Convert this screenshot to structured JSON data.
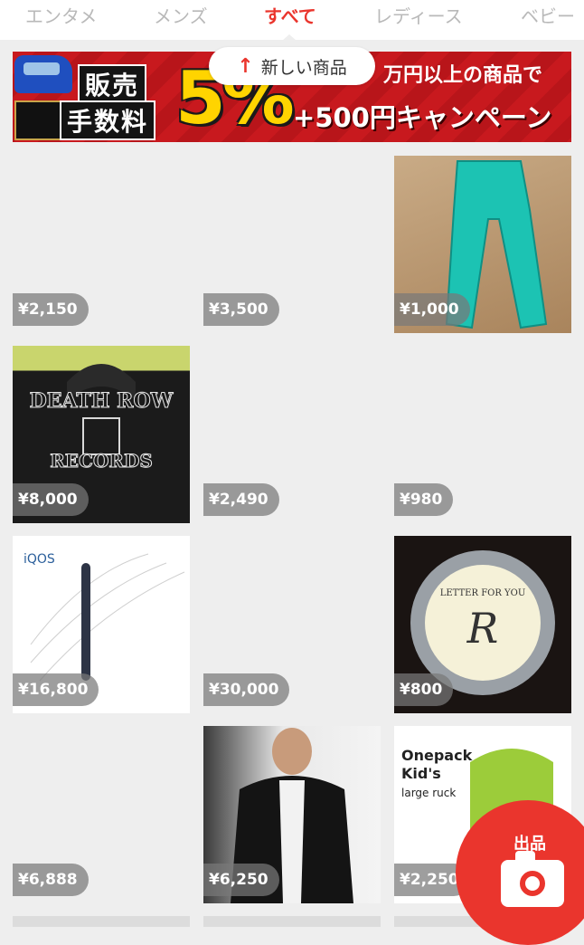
{
  "tabs": [
    {
      "label": "エンタメ",
      "active": false
    },
    {
      "label": "メンズ",
      "active": false
    },
    {
      "label": "すべて",
      "active": true
    },
    {
      "label": "レディース",
      "active": false
    },
    {
      "label": "ベビー",
      "active": false
    }
  ],
  "banner": {
    "label_sale": "販売",
    "label_fee": "手数料",
    "percent": "5%",
    "top_text": "万円以上の商品で",
    "bottom_text": "+500円キャンペーン"
  },
  "new_items": {
    "label": "新しい商品",
    "icon": "arrow-up-icon"
  },
  "items": [
    {
      "price": "¥2,150",
      "photo": "none"
    },
    {
      "price": "¥3,500",
      "photo": "none"
    },
    {
      "price": "¥1,000",
      "photo": "turquoise-pants"
    },
    {
      "price": "¥8,000",
      "photo": "death-row-hoodie"
    },
    {
      "price": "¥2,490",
      "photo": "none"
    },
    {
      "price": "¥980",
      "photo": "none"
    },
    {
      "price": "¥16,800",
      "photo": "iqos-box"
    },
    {
      "price": "¥30,000",
      "photo": "none"
    },
    {
      "price": "¥800",
      "photo": "letter-tin"
    },
    {
      "price": "¥6,888",
      "photo": "none"
    },
    {
      "price": "¥6,250",
      "photo": "leather-jacket"
    },
    {
      "price": "¥2,250",
      "photo": "green-backpack"
    }
  ],
  "photo_text": {
    "hoodie_top": "DEATH ROW",
    "hoodie_bottom": "RECORDS",
    "iqos_logo": "iQOS",
    "tin_top": "LETTER FOR YOU",
    "tin_letter": "R",
    "backpack_title1": "Onepack",
    "backpack_title2": "Kid's",
    "backpack_sub": "large ruck"
  },
  "fab": {
    "label": "出品",
    "icon": "camera-icon"
  },
  "colors": {
    "accent": "#ea352d",
    "tab_inactive": "#b9b9b9",
    "background": "#eeeeee"
  }
}
